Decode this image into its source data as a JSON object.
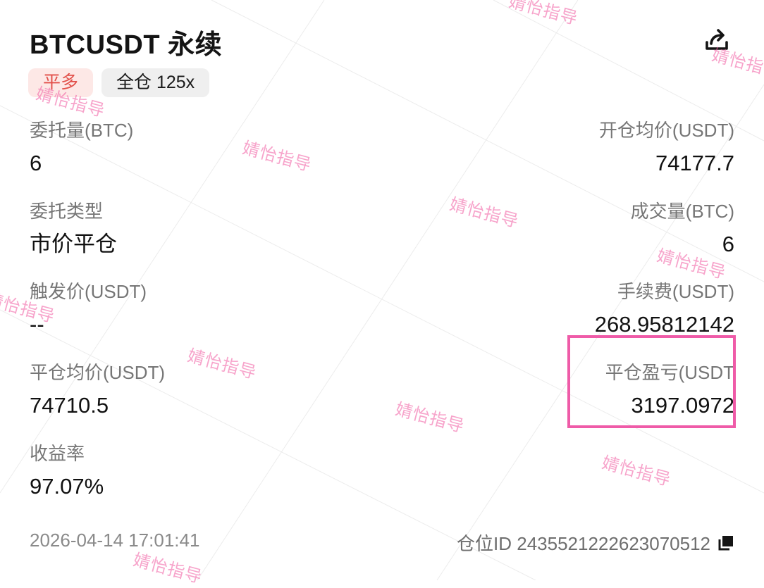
{
  "header": {
    "title": "BTCUSDT 永续",
    "share_icon": "share-icon"
  },
  "tags": {
    "side": "平多",
    "margin": "全仓 125x"
  },
  "fields": {
    "order_qty": {
      "label": "委托量(BTC)",
      "value": "6"
    },
    "open_avg_price": {
      "label": "开仓均价(USDT)",
      "value": "74177.7"
    },
    "order_type": {
      "label": "委托类型",
      "value": "市价平仓"
    },
    "filled_qty": {
      "label": "成交量(BTC)",
      "value": "6"
    },
    "trigger_price": {
      "label": "触发价(USDT)",
      "value": "--"
    },
    "fee": {
      "label": "手续费(USDT)",
      "value": "268.95812142"
    },
    "close_avg_price": {
      "label": "平仓均价(USDT)",
      "value": "74710.5"
    },
    "close_pnl": {
      "label": "平仓盈亏(USDT",
      "value": "3197.0972"
    },
    "roi": {
      "label": "收益率",
      "value": "97.07%"
    }
  },
  "footer": {
    "time": "2026-04-14 17:01:41",
    "position_id": "仓位ID 2435521222623070512",
    "copy_icon": "copy-icon"
  },
  "watermark": {
    "text": "婧怡指导",
    "color": "#f05aa0"
  },
  "colors": {
    "highlight": "#ef5ba8",
    "tag_side_text": "#e2504a",
    "tag_side_bg": "#fde8e6"
  }
}
